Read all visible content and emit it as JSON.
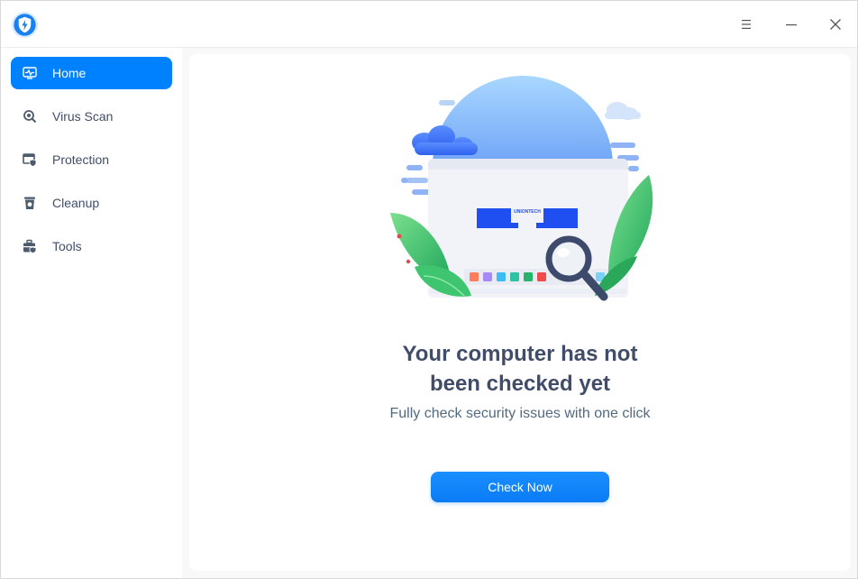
{
  "titlebar": {
    "logo_icon": "shield-bolt-icon",
    "menu_icon": "hamburger-menu-icon",
    "minimize_icon": "minimize-icon",
    "close_icon": "close-icon"
  },
  "sidebar": {
    "items": [
      {
        "label": "Home",
        "icon": "monitor-pulse-icon",
        "active": true
      },
      {
        "label": "Virus Scan",
        "icon": "magnifier-scan-icon",
        "active": false
      },
      {
        "label": "Protection",
        "icon": "window-shield-icon",
        "active": false
      },
      {
        "label": "Cleanup",
        "icon": "trash-bin-icon",
        "active": false
      },
      {
        "label": "Tools",
        "icon": "toolbox-icon",
        "active": false
      }
    ]
  },
  "main": {
    "illustration_brand": "UNIONTECH",
    "headline_line1": "Your computer has not",
    "headline_line2": "been checked yet",
    "subline": "Fully check security issues with one click",
    "check_button": "Check Now"
  },
  "colors": {
    "accent": "#0081ff",
    "text": "#414d68",
    "leaf_green": "#2ebd6b",
    "sky_blue": "#8cc4ff"
  }
}
